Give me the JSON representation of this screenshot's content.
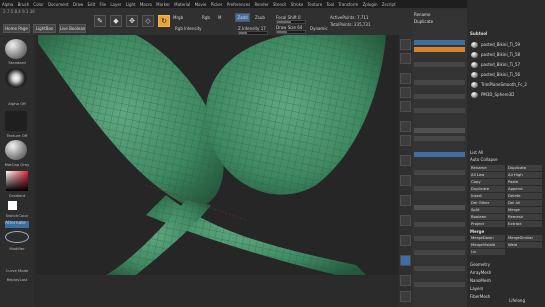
{
  "menu": [
    "Alpha",
    "Brush",
    "Color",
    "Document",
    "Draw",
    "Edit",
    "File",
    "Layer",
    "Light",
    "Macro",
    "Marker",
    "Material",
    "Movie",
    "Picker",
    "Preferences",
    "Render",
    "Stencil",
    "Stroke",
    "Texture",
    "Tool",
    "Transform",
    "Zplugin",
    "Zscript"
  ],
  "status_info": "2.7.5 8.4 9.1 36",
  "toolbar": {
    "home_page": "Home Page",
    "lightbox": "LightBox",
    "live_boolean": "Live Boolean",
    "mrgb": "Mrgb",
    "rgb": "Rgb",
    "m": "M",
    "zadd": "Zadd",
    "zsub": "Zsub",
    "zcut": "Zcut",
    "rgb_intensity": "Rgb Intensity",
    "z_intensity": "Z Intensity 17",
    "focal_shift": "Focal Shift 0",
    "draw_size": "Draw Size 64",
    "dynamic": "Dynamic",
    "active_points": "ActivePoints: 7,711",
    "total_points": "TotalPoints: 235,731"
  },
  "left_shelf": {
    "brush1": "Standard",
    "brush2": "Alpha Off",
    "brush3": "Texture Off",
    "brush4": "MatCap Gray",
    "gradient": "Gradient",
    "switch_color": "SwitchColor",
    "alternate": "Alternate",
    "modifier": "Modifier",
    "curve_mode": "Curve Mode",
    "replay_last": "ReplayLast"
  },
  "panel1": {
    "items": [
      "Rename",
      "Duplicate",
      "Append",
      "Insert",
      "Delete",
      "Split",
      "Merge",
      "Boolean",
      "Remesh",
      "Project",
      "Extract"
    ],
    "bars": [
      "Subdivide",
      "Lower Res",
      "Higher Res",
      "Del Lower",
      "Del Higher",
      "Freeze SubD",
      "Dynamic Subdiv",
      "Geometry HD",
      "Layers",
      "FiberMesh",
      "Preview",
      "Surface",
      "Deformation",
      "Masking",
      "Visibility",
      "Polygroups",
      "Contact",
      "Morph Target",
      "Polypaint"
    ]
  },
  "panel2": {
    "subtool_title": "Subtool",
    "subtools": [
      "pasted_Bikini_Ti_59",
      "pasted_Bikini_Ti_58",
      "pasted_Bikini_Ti_57",
      "pasted_Bikini_Ti_56",
      "TrimPlaneSmooth_Fc_2",
      "PM3D_Sphere3D"
    ],
    "list_all": "List All",
    "auto_collapse": "Auto Collapse",
    "buttons": [
      "Rename",
      "Duplicate",
      "All Low",
      "All High",
      "Copy",
      "Paste",
      "Duplicate",
      "Append",
      "Insert",
      "Delete",
      "Del Other",
      "Del All",
      "Split",
      "Merge",
      "Boolean",
      "Remesh",
      "Project",
      "Extract"
    ],
    "sub_labels": [
      "Geometry",
      "ArrayMesh",
      "NanoMesh",
      "Layers",
      "FiberMesh"
    ],
    "merge_title": "Merge",
    "merge_items": [
      "MergeDown",
      "MergeSimilar",
      "MergeVisible",
      "Weld",
      "Uv"
    ]
  },
  "watermark": "Lifelong",
  "colors": {
    "accent": "#e8a33a",
    "mesh": "#3f8a63",
    "active_blue": "#3d6ea3"
  }
}
